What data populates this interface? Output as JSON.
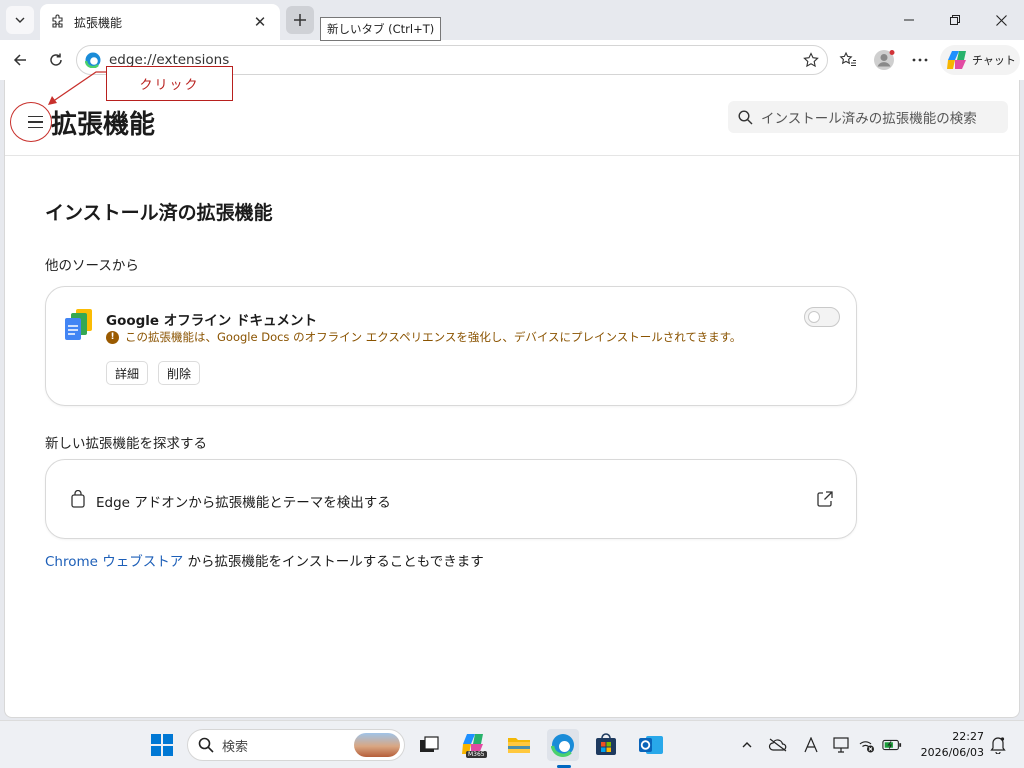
{
  "tabstrip": {
    "tab_title": "拡張機能",
    "tooltip": "新しいタブ (Ctrl+T)"
  },
  "toolbar": {
    "url": "edge://extensions",
    "copilot_label": "チャット"
  },
  "page": {
    "title": "拡張機能",
    "search_placeholder": "インストール済みの拡張機能の検索",
    "section_title": "インストール済の拡張機能",
    "other_sources_heading": "他のソースから",
    "extension": {
      "name": "Google オフライン ドキュメント",
      "warning": "この拡張機能は、Google Docs のオフライン エクスペリエンスを強化し、デバイスにプレインストールされてきます。",
      "details_label": "詳細",
      "remove_label": "削除",
      "enabled": false
    },
    "discover_heading": "新しい拡張機能を探求する",
    "addons_label": "Edge アドオンから拡張機能とテーマを検出する",
    "chrome_store_link": "Chrome ウェブストア",
    "chrome_store_text": " から拡張機能をインストールすることもできます"
  },
  "annotation": {
    "label": "クリック"
  },
  "taskbar": {
    "search_placeholder": "検索",
    "time": "22:27",
    "date": "2026/06/03",
    "m365_badge": "M365"
  }
}
